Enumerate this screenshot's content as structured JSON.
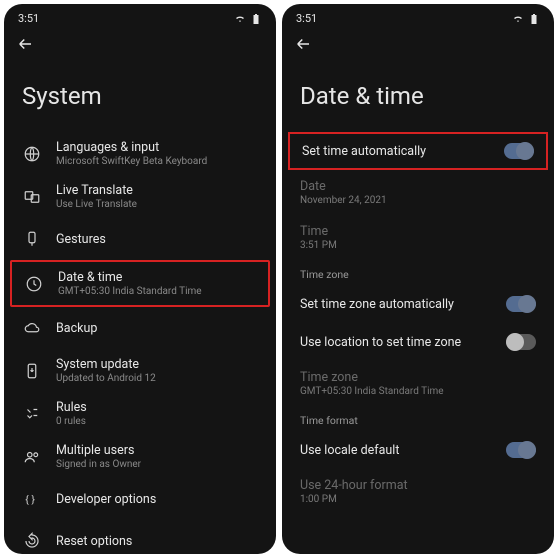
{
  "status": {
    "time": "3:51"
  },
  "left": {
    "title": "System",
    "items": [
      {
        "icon": "globe",
        "label": "Languages & input",
        "sub": "Microsoft SwiftKey Beta Keyboard"
      },
      {
        "icon": "translate",
        "label": "Live Translate",
        "sub": "Use Live Translate"
      },
      {
        "icon": "gesture",
        "label": "Gestures",
        "sub": ""
      },
      {
        "icon": "clock",
        "label": "Date & time",
        "sub": "GMT+05:30 India Standard Time",
        "highlighted": true
      },
      {
        "icon": "cloud",
        "label": "Backup",
        "sub": ""
      },
      {
        "icon": "update",
        "label": "System update",
        "sub": "Updated to Android 12"
      },
      {
        "icon": "rules",
        "label": "Rules",
        "sub": "0 rules"
      },
      {
        "icon": "people",
        "label": "Multiple users",
        "sub": "Signed in as Owner"
      },
      {
        "icon": "braces",
        "label": "Developer options",
        "sub": ""
      },
      {
        "icon": "reset",
        "label": "Reset options",
        "sub": ""
      }
    ]
  },
  "right": {
    "title": "Date & time",
    "rows": {
      "setTimeAuto": {
        "label": "Set time automatically",
        "toggle": "on",
        "highlighted": true
      },
      "date": {
        "label": "Date",
        "sub": "November 24, 2021",
        "disabled": true
      },
      "time": {
        "label": "Time",
        "sub": "3:51 PM",
        "disabled": true
      }
    },
    "sections": {
      "tz": {
        "header": "Time zone",
        "rows": {
          "autoTz": {
            "label": "Set time zone automatically",
            "toggle": "on"
          },
          "useLoc": {
            "label": "Use location to set time zone",
            "toggle": "off"
          },
          "tzVal": {
            "label": "Time zone",
            "sub": "GMT+05:30 India Standard Time",
            "disabled": true
          }
        }
      },
      "fmt": {
        "header": "Time format",
        "rows": {
          "locale": {
            "label": "Use locale default",
            "toggle": "on"
          },
          "use24": {
            "label": "Use 24-hour format",
            "sub": "1:00 PM",
            "disabled": true
          }
        }
      }
    }
  }
}
